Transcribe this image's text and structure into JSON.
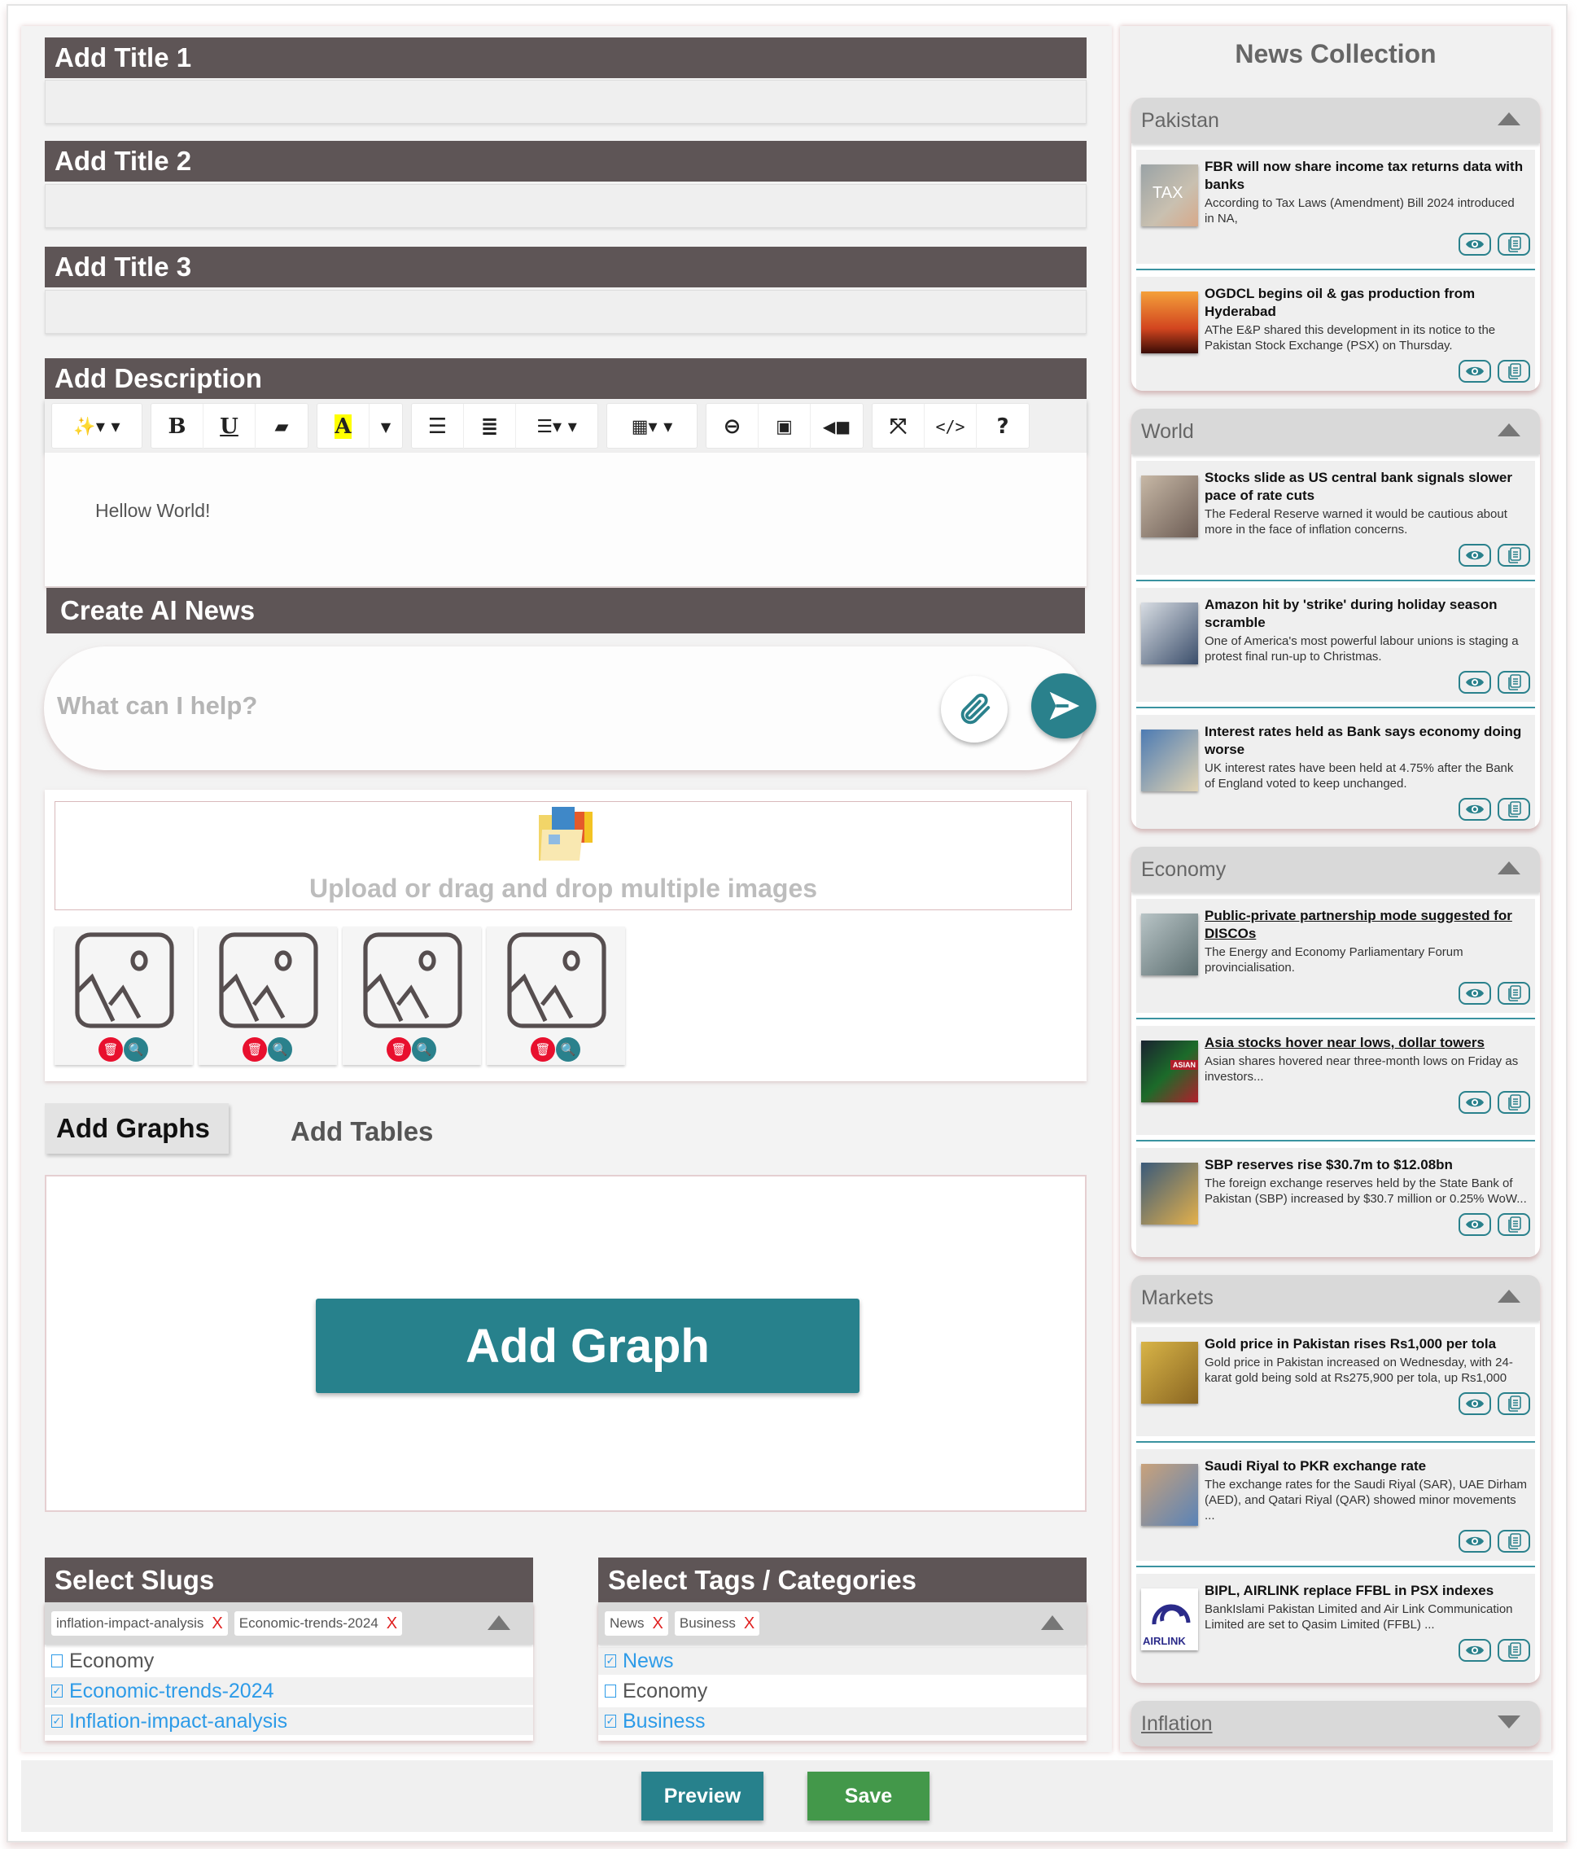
{
  "form": {
    "title1": "Add Title 1",
    "title2": "Add Title 2",
    "title3": "Add Title 3",
    "description": "Add Description",
    "editor_text": "Hellow World!",
    "ai_news": "Create AI News",
    "chat_placeholder": "What can I help?",
    "upload_text": "Upload or drag and drop multiple images",
    "tabs": [
      "Add Graphs",
      "Add Tables"
    ],
    "add_graph": "Add Graph",
    "slugs": {
      "title": "Select Slugs",
      "chips": [
        "inflation-impact-analysis",
        "Economic-trends-2024"
      ],
      "options": [
        {
          "label": "Economy",
          "checked": false
        },
        {
          "label": "Economic-trends-2024",
          "checked": true
        },
        {
          "label": "Inflation-impact-analysis",
          "checked": true
        }
      ]
    },
    "tags": {
      "title": "Select  Tags / Categories",
      "chips": [
        "News",
        "Business"
      ],
      "options": [
        {
          "label": "News",
          "checked": true
        },
        {
          "label": "Economy",
          "checked": false
        },
        {
          "label": "Business",
          "checked": true
        }
      ]
    },
    "chip_remove": "X",
    "check": "✓",
    "preview": "Preview",
    "save": "Save"
  },
  "colors": {
    "bar": "#5e5556",
    "accent": "#2a818c",
    "save": "#43984a",
    "delete": "#e8102e"
  },
  "news": {
    "title": "News Collection",
    "sections": [
      {
        "name": "Pakistan",
        "expanded": true,
        "items": [
          {
            "title": "FBR will now share income tax returns data with banks",
            "body": "According to Tax Laws (Amendment) Bill 2024 introduced in NA,",
            "img": "TAX"
          },
          {
            "title": "OGDCL begins oil & gas production from Hyderabad",
            "body": "AThe E&P shared this development in its notice to the Pakistan Stock Exchange (PSX) on Thursday."
          }
        ]
      },
      {
        "name": "World",
        "expanded": true,
        "items": [
          {
            "title": "Stocks slide as US central bank signals slower pace of rate cuts",
            "body": "The Federal Reserve warned it would be cautious about more   in the face of inflation concerns."
          },
          {
            "title": "Amazon hit by 'strike' during holiday season scramble",
            "body": "One of America's most powerful labour unions is staging a protest  final run-up to Christmas."
          },
          {
            "title": "Interest rates held as Bank says economy doing worse",
            "body": "UK interest rates have been held at 4.75% after the Bank of England voted to keep   unchanged."
          }
        ]
      },
      {
        "name": "Economy",
        "expanded": true,
        "items": [
          {
            "title": "Public-private partnership mode suggested for DISCOs",
            "body": "The Energy and Economy Parliamentary Forum provincialisation.",
            "link": true
          },
          {
            "title": "Asia stocks hover near lows, dollar towers",
            "body": "Asian shares hovered near three-month lows on Friday as investors...",
            "link": true,
            "img": "ASIAN"
          },
          {
            "title": "SBP reserves rise $30.7m to $12.08bn",
            "body": "The foreign exchange reserves held by the State Bank of Pakistan (SBP) increased by $30.7 million or 0.25% WoW..."
          }
        ]
      },
      {
        "name": "Markets",
        "expanded": true,
        "items": [
          {
            "title": "Gold price in Pakistan rises Rs1,000 per tola",
            "body": "Gold price in Pakistan increased on Wednesday, with 24-karat gold being sold at Rs275,900 per tola, up Rs1,000"
          },
          {
            "title": "Saudi Riyal to PKR exchange rate",
            "body": "The exchange rates for the Saudi Riyal (SAR), UAE Dirham (AED), and Qatari Riyal (QAR) showed minor movements ..."
          },
          {
            "title": "BIPL, AIRLINK replace FFBL in PSX indexes",
            "body": "BankIslami Pakistan Limited and Air Link Communication Limited are set to   Qasim Limited (FFBL)  ...",
            "img": "AIRLINK"
          }
        ]
      },
      {
        "name": "Inflation",
        "expanded": false,
        "items": []
      }
    ]
  }
}
